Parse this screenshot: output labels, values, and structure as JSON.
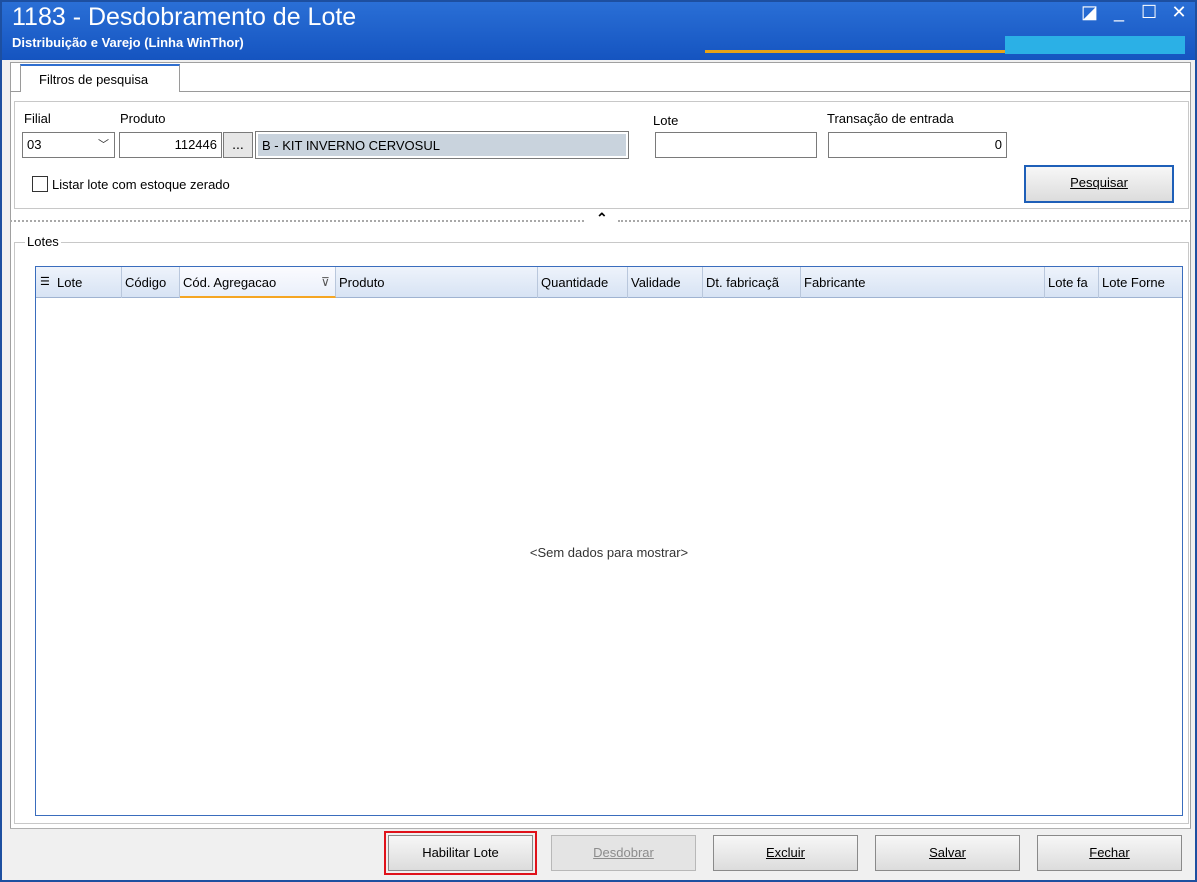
{
  "window": {
    "title": "1183 - Desdobramento de Lote",
    "subtitle": "Distribuição e Varejo (Linha WinThor)",
    "controls": {
      "restore": "◪",
      "minimize": "_",
      "maximize": "☐",
      "close": "✕"
    }
  },
  "tabs": [
    {
      "label": "Filtros de pesquisa"
    }
  ],
  "filters": {
    "filial_label": "Filial",
    "filial_value": "03",
    "produto_label": "Produto",
    "produto_code": "112446",
    "produto_browse": "...",
    "produto_desc": "B - KIT INVERNO CERVOSUL",
    "lote_label": "Lote",
    "lote_value": "",
    "transacao_label": "Transação de entrada",
    "transacao_value": "0",
    "checkbox_label": "Listar lote com estoque zerado",
    "pesquisar_label": "Pesquisar"
  },
  "lotes": {
    "group_label": "Lotes",
    "columns": [
      "Lote",
      "Código",
      "Cód. Agregacao",
      "Produto",
      "Quantidade",
      "Validade",
      "Dt. fabricaçã",
      "Fabricante",
      "Lote fa",
      "Lote Forne"
    ],
    "empty_text": "<Sem dados para mostrar>"
  },
  "actions": {
    "habilitar": "Habilitar Lote",
    "desdobrar": "Desdobrar",
    "excluir": "Excluir",
    "salvar": "Salvar",
    "fechar": "Fechar"
  },
  "colors": {
    "title_bar": "#1554c0",
    "highlight": "#e0121a",
    "accent": "#e8a317"
  }
}
